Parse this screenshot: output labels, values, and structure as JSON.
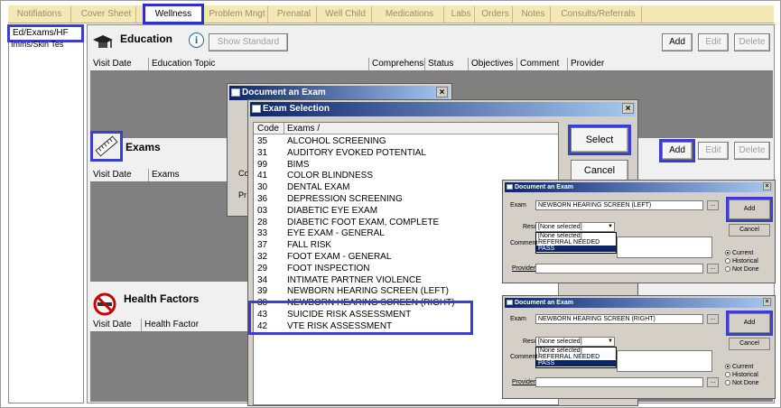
{
  "tabs": [
    {
      "label": "Notifiations"
    },
    {
      "label": "Cover Sheet"
    },
    {
      "label": "Wellness"
    },
    {
      "label": "Problem Mngt"
    },
    {
      "label": "Prenatal"
    },
    {
      "label": "Well Child"
    },
    {
      "label": "Medications"
    },
    {
      "label": "Labs"
    },
    {
      "label": "Orders"
    },
    {
      "label": "Notes"
    },
    {
      "label": "Consults/Referrals"
    }
  ],
  "sidebar": {
    "items": [
      {
        "label": "Ed/Exams/HF"
      },
      {
        "label": "Imms/Skin Tes"
      }
    ]
  },
  "education": {
    "title": "Education",
    "show_standard": "Show Standard",
    "add": "Add",
    "edit": "Edit",
    "delete": "Delete",
    "columns": [
      "Visit Date",
      "Education Topic",
      "Comprehensi",
      "Status",
      "Objectives",
      "Comment",
      "Provider"
    ]
  },
  "exams": {
    "title": "Exams",
    "add": "Add",
    "edit": "Edit",
    "delete": "Delete",
    "columns": [
      "Visit Date",
      "Exams"
    ]
  },
  "health_factors": {
    "title": "Health Factors",
    "columns": [
      "Visit Date",
      "Health Factor"
    ]
  },
  "document_exam_bg": {
    "title": "Document an Exam",
    "partial_label_1": "Co",
    "partial_label_2": "Pr"
  },
  "exam_selection": {
    "title": "Exam Selection",
    "col_code": "Code",
    "col_exams": "Exams",
    "sort_glyph": "/",
    "select": "Select",
    "cancel": "Cancel",
    "rows": [
      {
        "code": "35",
        "name": "ALCOHOL SCREENING"
      },
      {
        "code": "31",
        "name": "AUDITORY EVOKED POTENTIAL"
      },
      {
        "code": "99",
        "name": "BIMS"
      },
      {
        "code": "41",
        "name": "COLOR BLINDNESS"
      },
      {
        "code": "30",
        "name": "DENTAL EXAM"
      },
      {
        "code": "36",
        "name": "DEPRESSION SCREENING"
      },
      {
        "code": "03",
        "name": "DIABETIC EYE EXAM"
      },
      {
        "code": "28",
        "name": "DIABETIC FOOT EXAM, COMPLETE"
      },
      {
        "code": "33",
        "name": "EYE EXAM - GENERAL"
      },
      {
        "code": "37",
        "name": "FALL RISK"
      },
      {
        "code": "32",
        "name": "FOOT EXAM - GENERAL"
      },
      {
        "code": "29",
        "name": "FOOT INSPECTION"
      },
      {
        "code": "34",
        "name": "INTIMATE PARTNER VIOLENCE"
      },
      {
        "code": "39",
        "name": "NEWBORN HEARING SCREEN (LEFT)"
      },
      {
        "code": "38",
        "name": "NEWBORN HEARING SCREEN (RIGHT)"
      },
      {
        "code": "43",
        "name": "SUICIDE RISK ASSESSMENT"
      },
      {
        "code": "42",
        "name": "VTE RISK ASSESSMENT"
      }
    ]
  },
  "doc_left": {
    "title": "Document an Exam",
    "exam_label": "Exam",
    "exam_value": "NEWBORN HEARING SCREEN (LEFT)",
    "result_label": "Result",
    "result_value": "[None selected]",
    "comment_label": "Comment",
    "provider_label": "Provider",
    "options": [
      "[None selected]",
      "REFERRAL NEEDED",
      "PASS"
    ],
    "add": "Add",
    "cancel": "Cancel",
    "radios": [
      "Current",
      "Historical",
      "Not Done"
    ],
    "ellipsis": "..."
  },
  "doc_right": {
    "title": "Document an Exam",
    "exam_label": "Exam",
    "exam_value": "NEWBORN HEARING SCREEN (RIGHT)",
    "result_label": "Result",
    "result_value": "[None selected]",
    "comment_label": "Comment",
    "provider_label": "Provider",
    "options": [
      "[None selected]",
      "REFERRAL NEEDED",
      "PASS"
    ],
    "add": "Add",
    "cancel": "Cancel",
    "radios": [
      "Current",
      "Historical",
      "Not Done"
    ],
    "ellipsis": "..."
  },
  "colors": {
    "highlight": "#3a3fd0",
    "titlebar": "#0a246a",
    "tabbar": "#f4e8b4"
  }
}
